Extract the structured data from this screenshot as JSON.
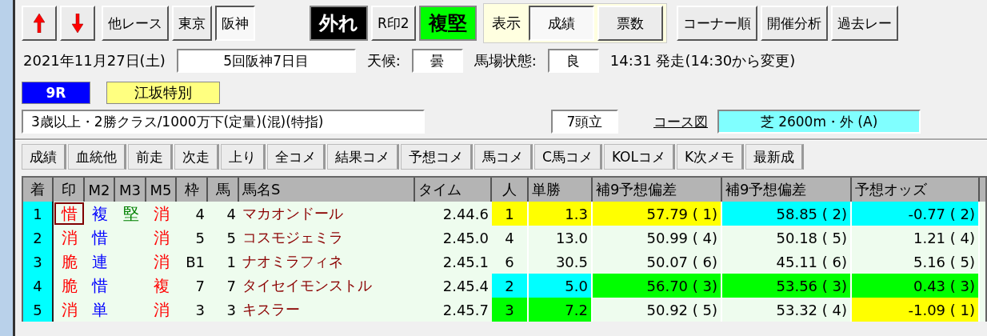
{
  "toolbar": {
    "nav": [
      {
        "kind": "up"
      },
      {
        "kind": "down"
      },
      {
        "kind": "text",
        "label": "他レース"
      },
      {
        "kind": "toggle",
        "label": "東京",
        "selected": false
      },
      {
        "kind": "toggle",
        "label": "阪神",
        "selected": true
      }
    ],
    "result": "外れ",
    "mark_button": "R印2",
    "verdict": "複堅",
    "display": {
      "label": "表示",
      "options": [
        {
          "label": "成績",
          "selected": true
        },
        {
          "label": "票数",
          "selected": false
        }
      ]
    },
    "tools": [
      "コーナー順",
      "開催分析",
      "過去レー"
    ]
  },
  "race": {
    "date": "2021年11月27日(土)",
    "meeting": "5回阪神7日目",
    "weather_label": "天候:",
    "weather": "曇",
    "track_label": "馬場状態:",
    "track": "良",
    "start": "14:31 発走(14:30から変更)",
    "number": "9R",
    "name": "江坂特別",
    "condition": "3歳以上・2勝クラス/1000万下(定量)(混)(特指)",
    "runners": "7頭立",
    "course_link": "コース図",
    "course": "芝 2600m・外 (A)"
  },
  "tabs": [
    "成績",
    "血統他",
    "前走",
    "次走",
    "上り",
    "全コメ",
    "結果コメ",
    "予想コメ",
    "馬コメ",
    "C馬コメ",
    "KOLコメ",
    "K次メモ",
    "最新成"
  ],
  "table": {
    "columns": [
      "着",
      "印",
      "M2",
      "M3",
      "M5",
      "枠",
      "馬",
      "馬名S",
      "タイム",
      "人",
      "単勝",
      "補9予想偏差",
      "補9予想偏差",
      "予想オッズ"
    ],
    "rows": [
      {
        "rank": "1",
        "mark": {
          "text": "惜",
          "color": "#ff0000",
          "focused": true
        },
        "m2": {
          "text": "複",
          "color": "#0000ff",
          "focused": false
        },
        "m3": {
          "text": "堅",
          "color": "#008000",
          "focused": false
        },
        "m5": {
          "text": "消",
          "color": "#ff0000",
          "focused": false
        },
        "waku": "4",
        "umaban": "4",
        "name": "マカオンドール",
        "time": "2.44.6",
        "pop": {
          "text": "1",
          "color": "#ffff00"
        },
        "odds": {
          "text": "1.3",
          "color": "#ffff00"
        },
        "dev1": {
          "text": "57.79 ( 1)",
          "color": "#ffff00"
        },
        "dev2": {
          "text": "58.85 ( 2)",
          "color": "#00ffff"
        },
        "yodds": {
          "text": "-0.77 ( 2)",
          "color": "#00ffff"
        }
      },
      {
        "rank": "2",
        "mark": {
          "text": "消",
          "color": "#ff0000",
          "focused": false
        },
        "m2": {
          "text": "惜",
          "color": "#0000ff",
          "focused": false
        },
        "m5": {
          "text": "消",
          "color": "#ff0000",
          "focused": false
        },
        "waku": "5",
        "umaban": "5",
        "name": "コスモジェミラ",
        "time": "2.45.0",
        "pop": {
          "text": "4"
        },
        "odds": {
          "text": "13.0"
        },
        "dev1": {
          "text": "50.99 ( 4)"
        },
        "dev2": {
          "text": "50.18 ( 5)"
        },
        "yodds": {
          "text": "1.21 ( 4)"
        }
      },
      {
        "rank": "3",
        "mark": {
          "text": "脆",
          "color": "#ff0000",
          "focused": false
        },
        "m2": {
          "text": "連",
          "color": "#0000ff",
          "focused": false
        },
        "m5": {
          "text": "消",
          "color": "#ff0000",
          "focused": false
        },
        "waku": "B1",
        "umaban": "1",
        "name": "ナオミラフィネ",
        "time": "2.45.1",
        "pop": {
          "text": "6"
        },
        "odds": {
          "text": "30.5"
        },
        "dev1": {
          "text": "50.07 ( 6)"
        },
        "dev2": {
          "text": "45.11 ( 6)"
        },
        "yodds": {
          "text": "5.16 ( 5)"
        }
      },
      {
        "rank": "4",
        "mark": {
          "text": "脆",
          "color": "#ff0000",
          "focused": false
        },
        "m2": {
          "text": "惜",
          "color": "#0000ff",
          "focused": false
        },
        "m5": {
          "text": "複",
          "color": "#ff0000",
          "focused": false
        },
        "waku": "7",
        "umaban": "7",
        "name": "タイセイモンストル",
        "time": "2.45.4",
        "pop": {
          "text": "2",
          "color": "#00ffff"
        },
        "odds": {
          "text": "5.0",
          "color": "#00ffff"
        },
        "dev1": {
          "text": "56.70 ( 3)",
          "color": "#00ff00"
        },
        "dev2": {
          "text": "53.56 ( 3)",
          "color": "#00ff00"
        },
        "yodds": {
          "text": "0.43 ( 3)",
          "color": "#00ff00"
        }
      },
      {
        "rank": "5",
        "mark": {
          "text": "消",
          "color": "#ff0000",
          "focused": false
        },
        "m2": {
          "text": "単",
          "color": "#0000ff",
          "focused": false
        },
        "m5": {
          "text": "消",
          "color": "#ff0000",
          "focused": false
        },
        "waku": "3",
        "umaban": "3",
        "name": "キスラー",
        "time": "2.45.7",
        "pop": {
          "text": "3",
          "color": "#00ff00"
        },
        "odds": {
          "text": "7.2",
          "color": "#00ff00"
        },
        "dev1": {
          "text": "50.92 ( 5)"
        },
        "dev2": {
          "text": "53.32 ( 4)"
        },
        "yodds": {
          "text": "-1.09 ( 1)",
          "color": "#ffff00"
        }
      }
    ]
  }
}
